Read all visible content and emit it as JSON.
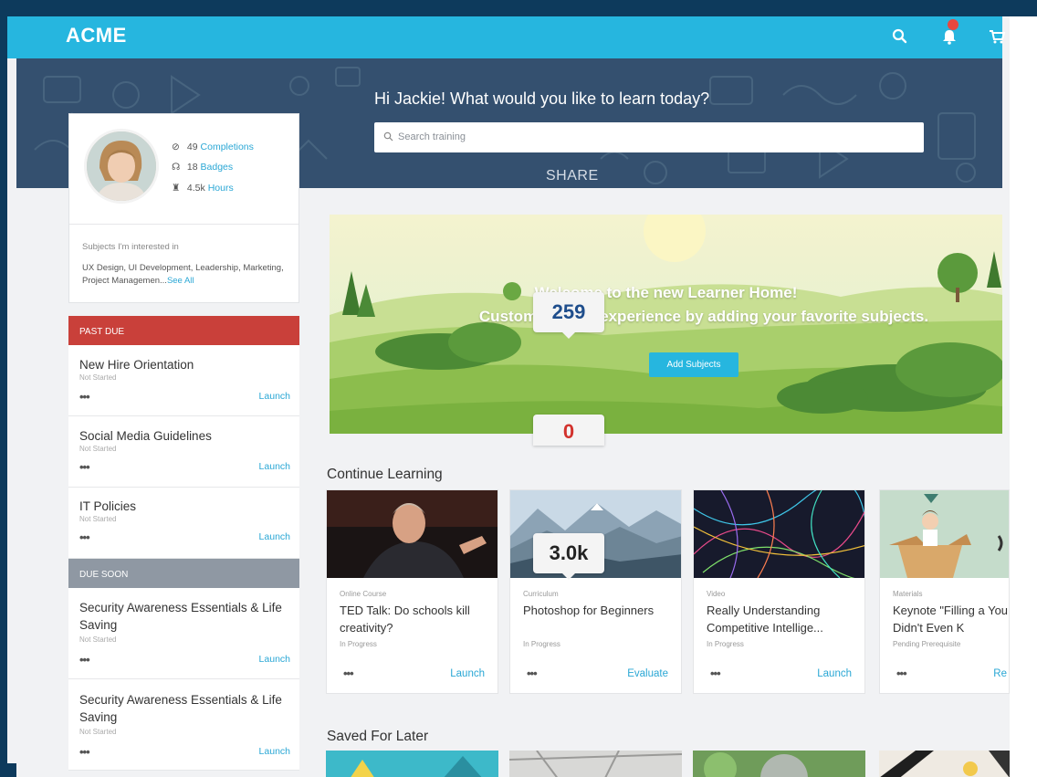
{
  "header": {
    "logo": "ACME"
  },
  "hero": {
    "greeting": "Hi Jackie! What would you like to learn today?",
    "search_placeholder": "Search training",
    "share": "SHARE"
  },
  "profile": {
    "completions_count": "49",
    "completions_label": "Completions",
    "badges_count": "18",
    "badges_label": "Badges",
    "hours_count": "4.5k",
    "hours_label": "Hours",
    "subjects_label": "Subjects I'm interested in",
    "subjects_text": "UX Design, UI Development, Leadership, Marketing, Project Managemen...",
    "see_all": "See All"
  },
  "past_due": {
    "heading": "PAST DUE",
    "items": [
      {
        "title": "New Hire Orientation",
        "status": "Not Started",
        "dots": "•••",
        "action": "Launch"
      },
      {
        "title": "Social Media Guidelines",
        "status": "Not Started",
        "dots": "•••",
        "action": "Launch"
      },
      {
        "title": "IT Policies",
        "status": "Not Started",
        "dots": "•••",
        "action": "Launch"
      }
    ]
  },
  "due_soon": {
    "heading": "DUE SOON",
    "items": [
      {
        "title": "Security Awareness Essentials & Life Saving",
        "status": "Not Started",
        "dots": "•••",
        "action": "Launch"
      },
      {
        "title": "Security Awareness Essentials & Life Saving",
        "status": "Not Started",
        "dots": "•••",
        "action": "Launch"
      }
    ]
  },
  "banner": {
    "line1": "Welcome to the new Learner Home!",
    "line2": "Customize your experience by adding your favorite subjects.",
    "button": "Add Subjects"
  },
  "overlays": {
    "views": "259",
    "zero": "0",
    "count": "3.0k"
  },
  "continue_learning": {
    "title": "Continue Learning",
    "cards": [
      {
        "type": "Online Course",
        "title": "TED Talk: Do schools kill creativity?",
        "status": "In Progress",
        "dots": "•••",
        "action": "Launch"
      },
      {
        "type": "Curriculum",
        "title": "Photoshop for Beginners",
        "status": "In Progress",
        "dots": "•••",
        "action": "Evaluate"
      },
      {
        "type": "Video",
        "title": "Really Understanding Competitive Intellige...",
        "status": "In Progress",
        "dots": "•••",
        "action": "Launch"
      },
      {
        "type": "Materials",
        "title": "Keynote \"Filling a You Didn't Even K",
        "status": "Pending Prerequisite",
        "dots": "•••",
        "action": "Re"
      }
    ]
  },
  "saved_for_later": {
    "title": "Saved For Later"
  },
  "colors": {
    "header": "#26b6df",
    "past_due": "#c9403a",
    "due_soon": "#8f98a3",
    "link": "#2aa7d5",
    "hero": "#34506f"
  }
}
